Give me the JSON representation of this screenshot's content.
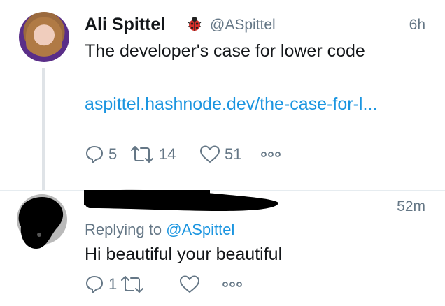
{
  "tweet": {
    "author_name": "Ali Spittel",
    "author_emoji": "ladybug-icon",
    "handle": "@ASpittel",
    "time": "6h",
    "text": "The developer's case for lower code",
    "link": "aspittel.hashnode.dev/the-case-for-l...",
    "actions": {
      "replies": "5",
      "retweets": "14",
      "likes": "51"
    }
  },
  "reply": {
    "time": "52m",
    "replying_to_label": "Replying to",
    "replying_to_handle": "@ASpittel",
    "text": "Hi beautiful your beautiful",
    "actions": {
      "replies": "1"
    }
  },
  "colors": {
    "text": "#14171a",
    "muted": "#657786",
    "link": "#1b95e0",
    "thread_line": "#dfe3e7"
  }
}
